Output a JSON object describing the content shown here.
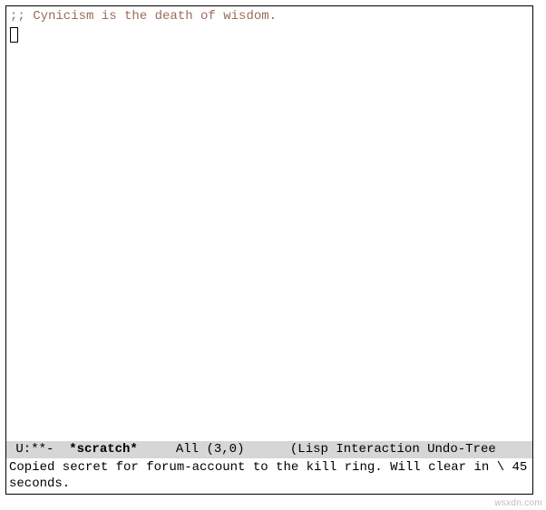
{
  "buffer": {
    "comment": ";; Cynicism is the death of wisdom."
  },
  "modeline": {
    "status": " U:**-  ",
    "buffer_name": "*scratch*",
    "gap1": "     ",
    "position": "All (3,0)",
    "gap2": "      ",
    "modes": "(Lisp Interaction Undo-Tree"
  },
  "echo": {
    "message": "Copied secret for forum-account to the kill ring. Will clear in \\\n45 seconds."
  },
  "watermark": "wsxdn.com"
}
